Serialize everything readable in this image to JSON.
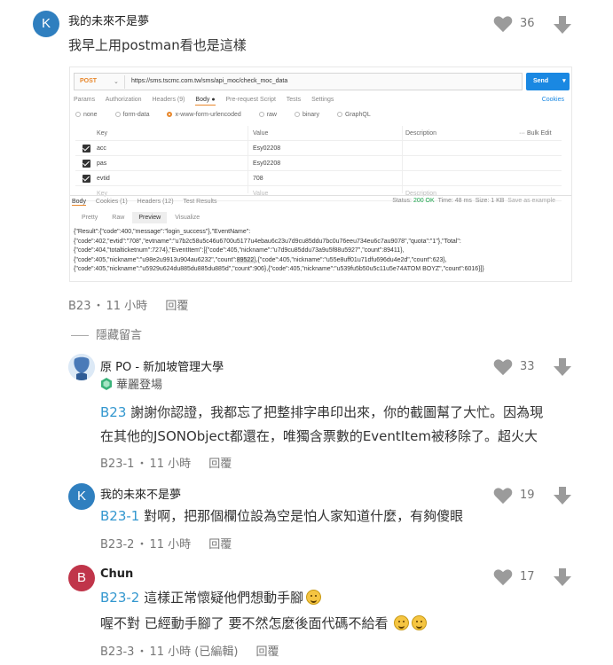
{
  "colors": {
    "avatar_k": "#2f7fbf",
    "avatar_b": "#c0354a",
    "avatar_po": "#4a7ab8",
    "mention": "#3397cf",
    "icon_gray": "#9b9b9b"
  },
  "comments": [
    {
      "avatar_letter": "K",
      "name": "我的未來不是夢",
      "text": "我早上用postman看也是這樣",
      "likes": "36",
      "floor": "B23",
      "time": "11 小時",
      "reply_label": "回覆"
    },
    {
      "name": "原 PO - 新加坡管理大學",
      "badge": "華麗登場",
      "mention": "B23",
      "text_line1": " 謝謝你認證，我都忘了把整排字串印出來，你的截圖幫了大忙。因為現",
      "text_line2": "在其他的JSONObject都還在，唯獨含票數的EventItem被移除了。超火大",
      "likes": "33",
      "floor": "B23-1",
      "time": "11 小時",
      "reply_label": "回覆"
    },
    {
      "avatar_letter": "K",
      "name": "我的未來不是夢",
      "mention": "B23-1",
      "text": " 對啊，把那個欄位設為空是怕人家知道什麼，有夠傻眼",
      "likes": "19",
      "floor": "B23-2",
      "time": "11 小時",
      "reply_label": "回覆"
    },
    {
      "avatar_letter": "B",
      "name": "Chun",
      "mention": "B23-2",
      "text_line1": " 這樣正常懷疑他們想動手腳",
      "text_line2": "喔不對 已經動手腳了 要不然怎麼後面代碼不給看",
      "likes": "17",
      "floor": "B23-3",
      "time": "11 小時 (已編輯)",
      "reply_label": "回覆"
    }
  ],
  "hidden_label": "隱藏留言",
  "postman": {
    "method": "POST",
    "url": "https://sms.tscmc.com.tw/sms/api_moc/check_moc_data",
    "send": "Send",
    "req_tabs": [
      "Params",
      "Authorization",
      "Headers (9)",
      "Body ●",
      "Pre-request Script",
      "Tests",
      "Settings"
    ],
    "cookies": "Cookies",
    "body_types": [
      "none",
      "form-data",
      "x-www-form-urlencoded",
      "raw",
      "binary",
      "GraphQL"
    ],
    "kv_header": {
      "key": "Key",
      "value": "Value",
      "desc": "Description",
      "edit": "··· Bulk Edit"
    },
    "kv_rows": [
      {
        "key": "acc",
        "value": "Esy02208"
      },
      {
        "key": "pas",
        "value": "Esy02208"
      },
      {
        "key": "evtid",
        "value": "708"
      }
    ],
    "kv_ghost": {
      "key": "Key",
      "value": "Value",
      "desc": "Description"
    },
    "resp_tabs": [
      "Body",
      "Cookies (1)",
      "Headers (12)",
      "Test Results"
    ],
    "status_label": "Status:",
    "status_value": "200 OK",
    "time_label": "Time: 48 ms",
    "size_label": "Size: 1 KB",
    "save_label": "Save as example",
    "view_tabs": [
      "Pretty",
      "Raw",
      "Preview",
      "Visualize"
    ],
    "json_line1": "{\"Result\":{\"code\":400,\"message\":\"login_success\"},\"EventName\":",
    "json_line2": "{\"code\":402,\"evtid\":\"708\",\"evtname\":\"u7b2c58u5c46u6700u5177u4ebau6c23u7d9cu85ddu7bc0u76eeu734eu6c7au9078\",\"quota\":\"1\"},\"Total\":",
    "json_line3": "{\"code\":404,\"totalticketnum\":7274},\"EventItem\":[{\"code\":405,\"nickname\":\"u7d9cu85ddu73a9u5f88u5927\",\"count\":89411},",
    "json_line4a": "{\"code\":405,\"nickname\":\"u98e2u9913u904au6232\",\"count\":",
    "json_line4b": "89522",
    "json_line4c": "},{\"code\":405,\"nickname\":\"u55e8uff01u71dfu696du4e2d\",\"count\":623},",
    "json_line5": "{\"code\":405,\"nickname\":\"u5929u624du885du885du885d\",\"count\":906},{\"code\":405,\"nickname\":\"u539fu5b50u5c11u5e74ATOM BOYZ\",\"count\":6016}]}"
  }
}
